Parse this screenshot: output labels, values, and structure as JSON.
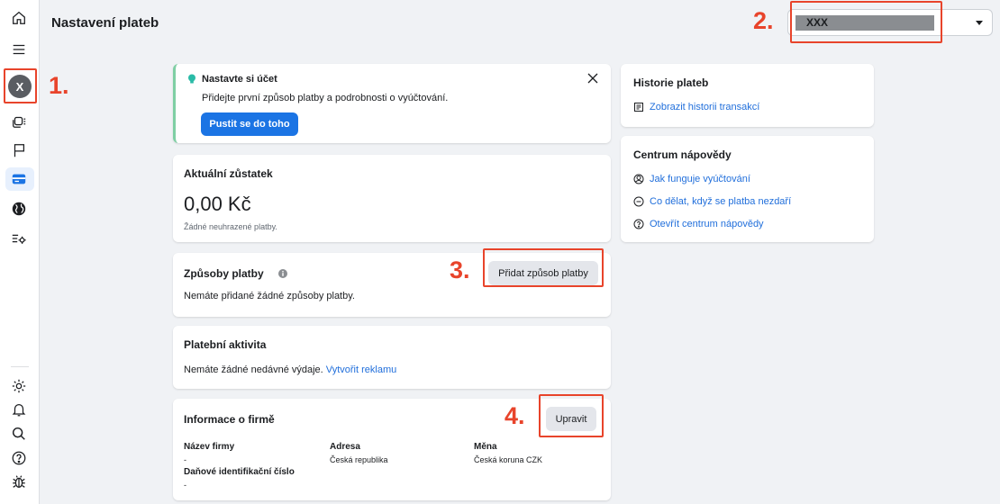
{
  "header": {
    "title": "Nastavení plateb",
    "account_name": "XXX"
  },
  "sidebar": {
    "avatar_letter": "X"
  },
  "markers": {
    "m1": "1.",
    "m2": "2.",
    "m3": "3.",
    "m4": "4."
  },
  "setup_card": {
    "title": "Nastavte si účet",
    "description": "Přidejte první způsob platby a podrobnosti o vyúčtování.",
    "button": "Pustit se do toho"
  },
  "balance_card": {
    "title": "Aktuální zůstatek",
    "amount": "0,00 Kč",
    "note": "Žádné neuhrazené platby."
  },
  "payment_methods_card": {
    "title": "Způsoby platby",
    "empty_text": "Nemáte přidané žádné způsoby platby.",
    "button": "Přidat způsob platby"
  },
  "activity_card": {
    "title": "Platební aktivita",
    "empty_text": "Nemáte žádné nedávné výdaje.",
    "link": "Vytvořit reklamu"
  },
  "business_card": {
    "title": "Informace o firmě",
    "button": "Upravit",
    "fields": {
      "name_label": "Název firmy",
      "name_value": "-",
      "address_label": "Adresa",
      "address_value": "Česká republika",
      "currency_label": "Měna",
      "currency_value": "Česká koruna CZK",
      "tax_label": "Daňové identifikační číslo",
      "tax_value": "-"
    }
  },
  "history_card": {
    "title": "Historie plateb",
    "link": "Zobrazit historii transakcí"
  },
  "help_card": {
    "title": "Centrum nápovědy",
    "links": [
      "Jak funguje vyúčtování",
      "Co dělat, když se platba nezdaří",
      "Otevřít centrum nápovědy"
    ]
  },
  "colors": {
    "accent": "#1b74e4",
    "link": "#216fdb",
    "highlight": "#e8442b",
    "setup_border": "#7fcfa4"
  }
}
